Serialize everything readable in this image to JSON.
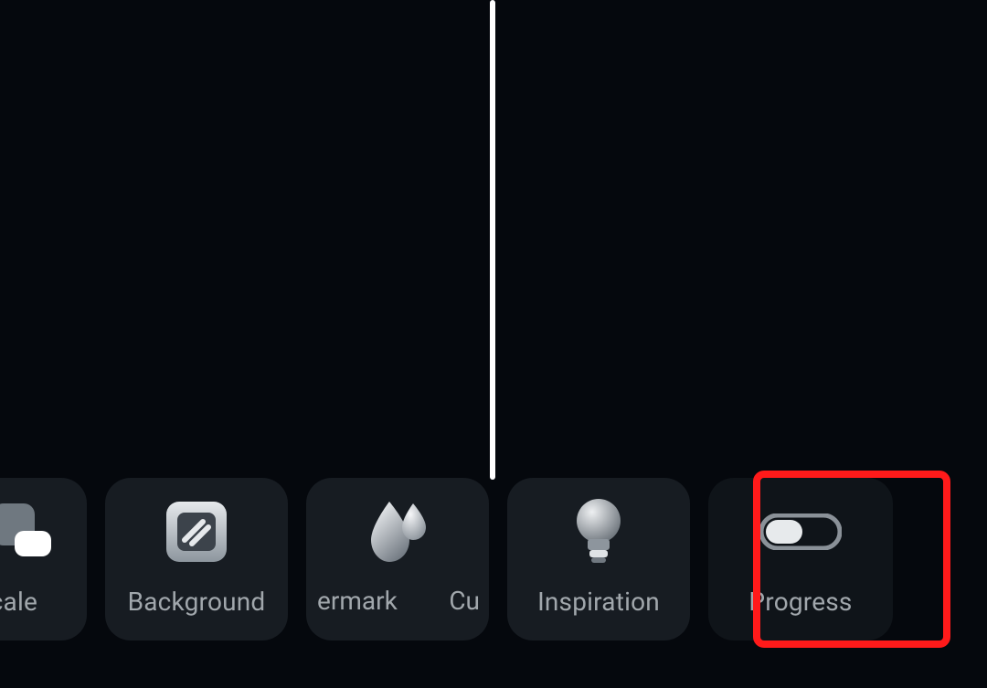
{
  "toolbar": {
    "items": [
      {
        "name": "scale",
        "label": "scale",
        "icon": "scale-icon"
      },
      {
        "name": "background",
        "label": "Background",
        "icon": "background-icon"
      },
      {
        "name": "watermark",
        "label_left": "ermark",
        "label_right": "Cu",
        "icon": "watermark-icon"
      },
      {
        "name": "inspiration",
        "label": "Inspiration",
        "icon": "lightbulb-icon"
      },
      {
        "name": "progress",
        "label": "Progress",
        "icon": "toggle-icon"
      }
    ]
  },
  "colors": {
    "highlight": "#ff1a1a",
    "background": "#05080d",
    "card": "#171c22",
    "label": "#a1a7ac"
  }
}
